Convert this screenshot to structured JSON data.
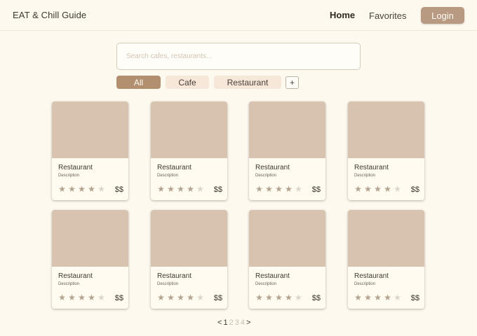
{
  "header": {
    "title": "EAT & Chill Guide",
    "nav": {
      "home": "Home",
      "favorites": "Favorites"
    },
    "login_label": "Login"
  },
  "search": {
    "placeholder": "Search cafes, restaurants..."
  },
  "filters": {
    "all": "All",
    "cafe": "Cafe",
    "restaurant": "Restaurant",
    "add": "+",
    "selected": "All"
  },
  "cards": [
    {
      "title": "Restaurant",
      "description": "Description",
      "rating": 4,
      "max_rating": 5,
      "price": "$$"
    },
    {
      "title": "Restaurant",
      "description": "Description",
      "rating": 4,
      "max_rating": 5,
      "price": "$$"
    },
    {
      "title": "Restaurant",
      "description": "Description",
      "rating": 4,
      "max_rating": 5,
      "price": "$$"
    },
    {
      "title": "Restaurant",
      "description": "Description",
      "rating": 4,
      "max_rating": 5,
      "price": "$$"
    },
    {
      "title": "Restaurant",
      "description": "Description",
      "rating": 4,
      "max_rating": 5,
      "price": "$$"
    },
    {
      "title": "Restaurant",
      "description": "Description",
      "rating": 4,
      "max_rating": 5,
      "price": "$$"
    },
    {
      "title": "Restaurant",
      "description": "Description",
      "rating": 4,
      "max_rating": 5,
      "price": "$$"
    },
    {
      "title": "Restaurant",
      "description": "Description",
      "rating": 4,
      "max_rating": 5,
      "price": "$$"
    }
  ],
  "pagination": {
    "prev": "<",
    "next": ">",
    "pages": [
      "1",
      "2",
      "3",
      "4"
    ],
    "current": "1"
  },
  "colors": {
    "background": "#fdf9ef",
    "accent": "#b2906f",
    "login_button": "#b89a82",
    "chip_inactive": "#f6e7d8",
    "card_image": "#d7c3b0"
  }
}
